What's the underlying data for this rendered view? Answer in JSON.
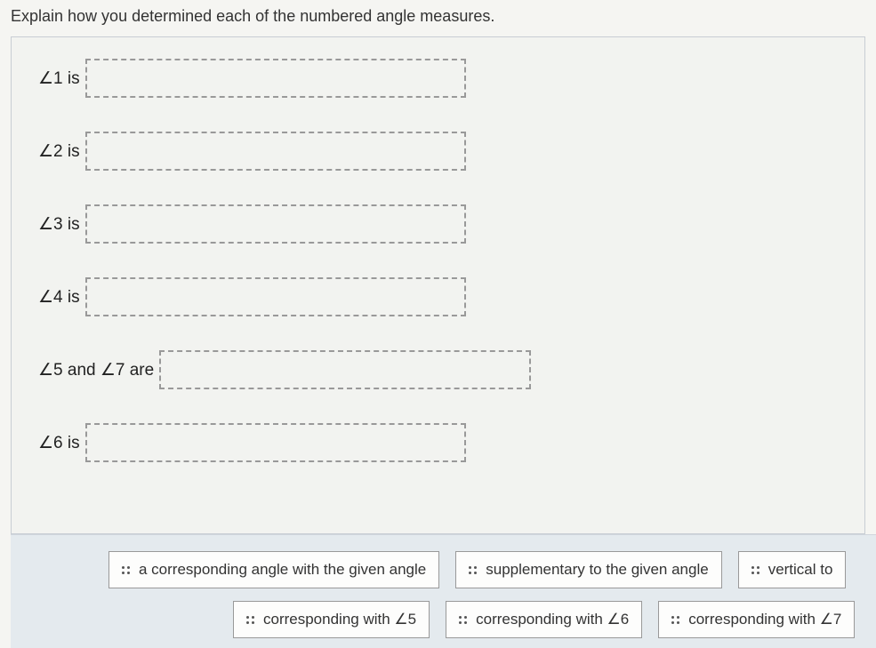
{
  "instruction": "Explain how you determined each of the numbered angle measures.",
  "rows": [
    {
      "label": "∠1 is"
    },
    {
      "label": "∠2 is"
    },
    {
      "label": "∠3 is"
    },
    {
      "label": "∠4 is"
    },
    {
      "label": "∠5 and ∠7 are"
    },
    {
      "label": "∠6 is"
    }
  ],
  "bank": {
    "row1": [
      "a corresponding angle with the given angle",
      "supplementary to the given angle",
      "vertical to"
    ],
    "row2": [
      "corresponding with ∠5",
      "corresponding with ∠6",
      "corresponding with ∠7"
    ]
  }
}
